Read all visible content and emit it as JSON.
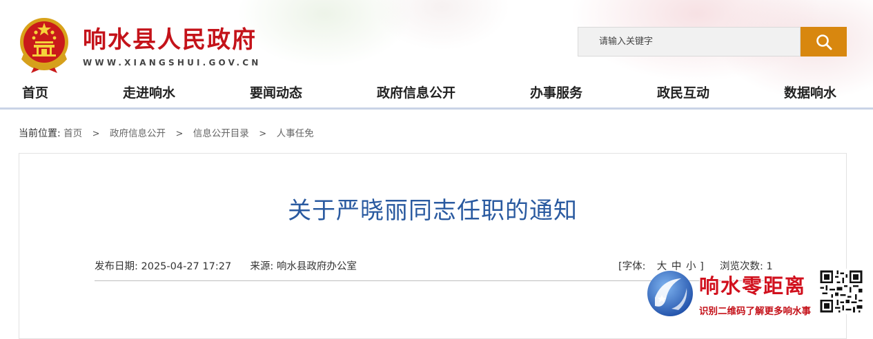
{
  "header": {
    "site_title": "响水县人民政府",
    "site_domain": "WWW.XIANGSHUI.GOV.CN",
    "search": {
      "placeholder": "请输入关键字"
    }
  },
  "nav": {
    "items": [
      {
        "label": "首页"
      },
      {
        "label": "走进响水"
      },
      {
        "label": "要闻动态"
      },
      {
        "label": "政府信息公开"
      },
      {
        "label": "办事服务"
      },
      {
        "label": "政民互动"
      },
      {
        "label": "数据响水"
      }
    ]
  },
  "breadcrumb": {
    "prefix": "当前位置:",
    "items": [
      "首页",
      "政府信息公开",
      "信息公开目录",
      "人事任免"
    ],
    "separator": ">"
  },
  "article": {
    "title": "关于严晓丽同志任职的通知",
    "publish_label": "发布日期:",
    "publish_date": "2025-04-27 17:27",
    "source_label": "来源:",
    "source": "响水县政府办公室",
    "font_label": "[字体:",
    "font_sizes": [
      "大",
      "中",
      "小"
    ],
    "font_close": "]",
    "views_label": "浏览次数:",
    "views": "1"
  },
  "promo": {
    "title": "响水零距离",
    "subtitle": "识别二维码了解更多响水事"
  },
  "colors": {
    "brand_red": "#c4131a",
    "search_button": "#d8870f",
    "title_blue": "#2a5aa0",
    "nav_rule": "#c9d3e6"
  }
}
